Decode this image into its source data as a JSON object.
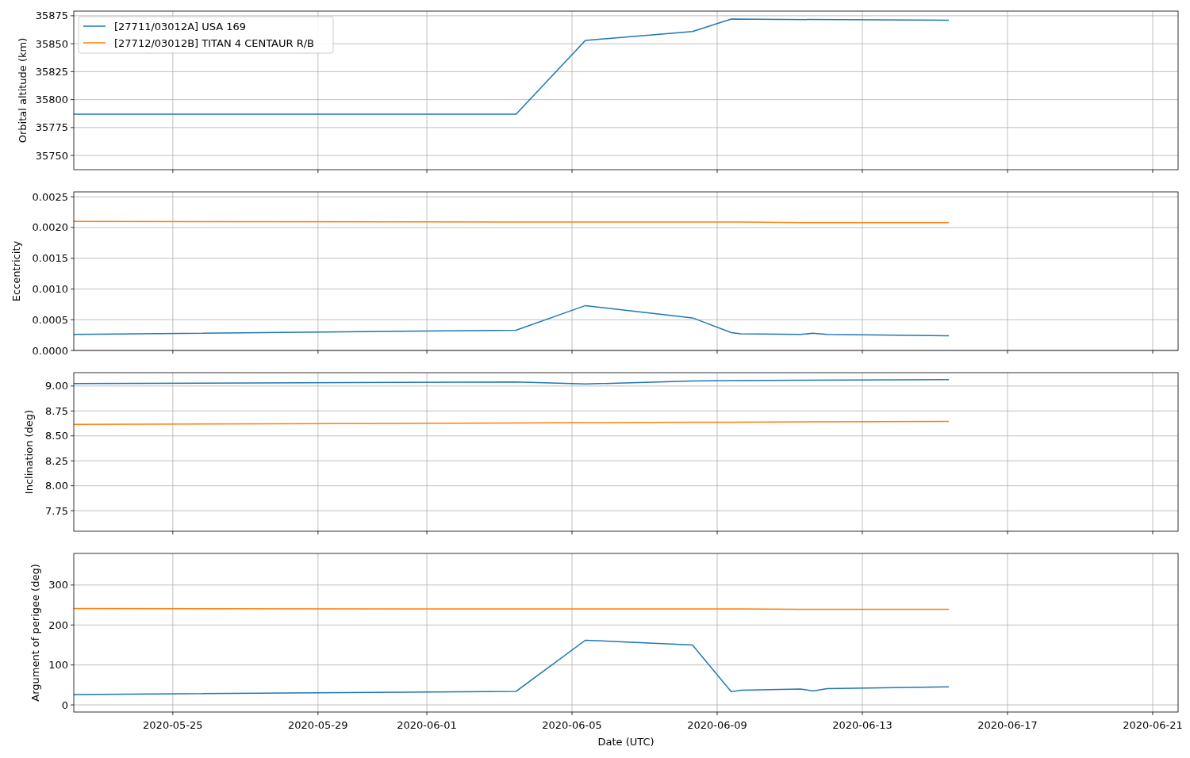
{
  "panels": [
    {
      "chart_data": {
        "type": "line",
        "grid": true,
        "ylabel": "Orbital altitude (km)",
        "xlim": [
          "2020-05-22T06:30",
          "2020-06-21T16:48"
        ],
        "ylim": [
          35737.3,
          35879.2
        ],
        "yticks": [
          {
            "value": 35750,
            "label": "35750"
          },
          {
            "value": 35775,
            "label": "35775"
          },
          {
            "value": 35800,
            "label": "35800"
          },
          {
            "value": 35825,
            "label": "35825"
          },
          {
            "value": 35850,
            "label": "35850"
          },
          {
            "value": 35875,
            "label": "35875"
          }
        ],
        "x": [
          "2020-05-22T06:30",
          "2020-06-03T11:00",
          "2020-06-05T08:50",
          "2020-06-08T07:40",
          "2020-06-09T09:20",
          "2020-06-15T09:10"
        ],
        "series": [
          {
            "name": "[27711/03012A] USA 169",
            "color": "#1f77b4",
            "values": [
              35787,
              35787,
              35853,
              35861,
              35872,
              35871
            ]
          },
          {
            "name": "[27712/03012B] TITAN 4 CENTAUR R/B",
            "color": "#ff7f0e",
            "values": [
              null,
              null,
              null,
              null,
              null,
              null
            ]
          }
        ]
      }
    },
    {
      "chart_data": {
        "type": "line",
        "grid": true,
        "ylabel": "Eccentricity",
        "xlim": [
          "2020-05-22T06:30",
          "2020-06-21T16:48"
        ],
        "ylim": [
          0,
          0.00258
        ],
        "yticks": [
          {
            "value": 0,
            "label": "0.0000"
          },
          {
            "value": 0.0005,
            "label": "0.0005"
          },
          {
            "value": 0.001,
            "label": "0.0010"
          },
          {
            "value": 0.0015,
            "label": "0.0015"
          },
          {
            "value": 0.002,
            "label": "0.0020"
          },
          {
            "value": 0.0025,
            "label": "0.0025"
          }
        ],
        "x": [
          "2020-05-22T06:30",
          "2020-06-03T11:00",
          "2020-06-05T08:50",
          "2020-06-08T07:40",
          "2020-06-09T09:20",
          "2020-06-09T15:40",
          "2020-06-11T07:00",
          "2020-06-11T15:20",
          "2020-06-12T00:40",
          "2020-06-15T09:10"
        ],
        "series": [
          {
            "color": "#1f77b4",
            "values": [
              0.00026,
              0.00033,
              0.00073,
              0.00053,
              0.00029,
              0.00027,
              0.00026,
              0.00028,
              0.00026,
              0.00024
            ]
          },
          {
            "color": "#ff7f0e",
            "values": [
              0.0021,
              0.00209,
              0.00209,
              0.00209,
              0.00209,
              0.00209,
              0.00208,
              0.00208,
              0.00208,
              0.00208
            ]
          }
        ]
      }
    },
    {
      "chart_data": {
        "type": "line",
        "grid": true,
        "ylabel": "Inclination (deg)",
        "xlim": [
          "2020-05-22T06:30",
          "2020-06-21T16:48"
        ],
        "ylim": [
          7.544,
          9.134
        ],
        "yticks": [
          {
            "value": 7.75,
            "label": "7.75"
          },
          {
            "value": 8,
            "label": "8.00"
          },
          {
            "value": 8.25,
            "label": "8.25"
          },
          {
            "value": 8.5,
            "label": "8.50"
          },
          {
            "value": 8.75,
            "label": "8.75"
          },
          {
            "value": 9,
            "label": "9.00"
          }
        ],
        "x": [
          "2020-05-22T06:30",
          "2020-06-03T11:00",
          "2020-06-05T08:50",
          "2020-06-08T07:40",
          "2020-06-09T09:20",
          "2020-06-15T09:10"
        ],
        "series": [
          {
            "color": "#1f77b4",
            "values": [
              9.025,
              9.04,
              9.02,
              9.05,
              9.055,
              9.065
            ]
          },
          {
            "color": "#ff7f0e",
            "values": [
              8.615,
              8.628,
              8.632,
              8.636,
              8.638,
              8.645
            ]
          }
        ]
      }
    },
    {
      "chart_data": {
        "type": "line",
        "grid": true,
        "xlabel": "Date (UTC)",
        "ylabel": "Argument of perigee (deg)",
        "xlim": [
          "2020-05-22T06:30",
          "2020-06-21T16:48"
        ],
        "ylim": [
          -17.8,
          379
        ],
        "xticks": [
          "2020-05-25",
          "2020-05-29",
          "2020-06-01",
          "2020-06-05",
          "2020-06-09",
          "2020-06-13",
          "2020-06-17",
          "2020-06-21"
        ],
        "yticks": [
          {
            "value": 0,
            "label": "0"
          },
          {
            "value": 100,
            "label": "100"
          },
          {
            "value": 200,
            "label": "200"
          },
          {
            "value": 300,
            "label": "300"
          }
        ],
        "x": [
          "2020-05-22T06:30",
          "2020-06-03T11:00",
          "2020-06-05T08:50",
          "2020-06-08T07:40",
          "2020-06-09T09:20",
          "2020-06-09T15:40",
          "2020-06-11T07:00",
          "2020-06-11T15:20",
          "2020-06-12T00:40",
          "2020-06-15T09:10"
        ],
        "series": [
          {
            "color": "#1f77b4",
            "values": [
              26,
              34,
              162,
              150,
              33,
              37,
              40,
              35,
              41,
              45
            ]
          },
          {
            "color": "#ff7f0e",
            "values": [
              241,
              240,
              240,
              240,
              240,
              240,
              239,
              239,
              239,
              239
            ]
          }
        ]
      }
    }
  ]
}
